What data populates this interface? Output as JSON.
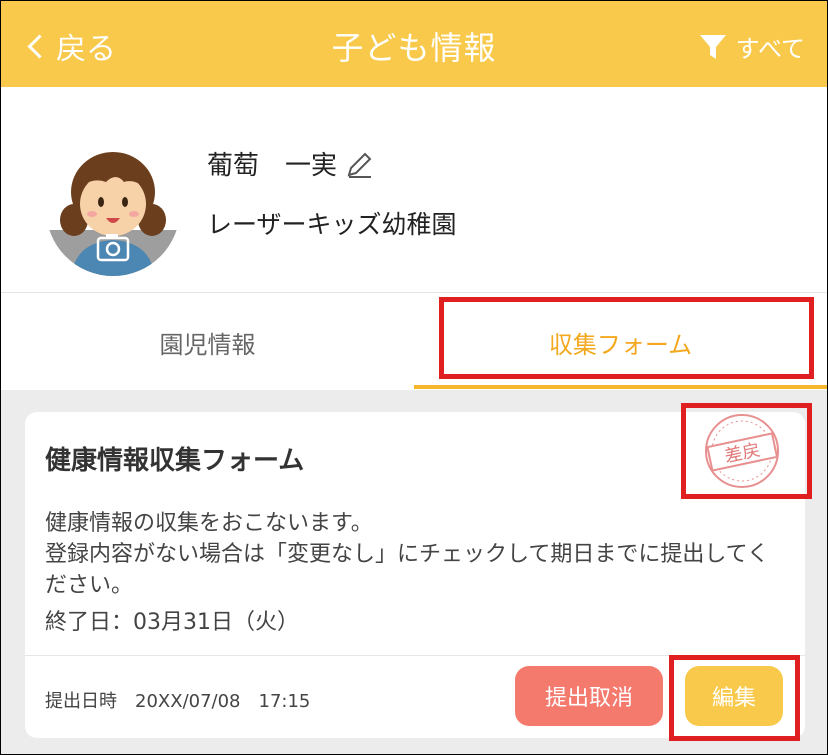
{
  "header": {
    "back_label": "戻る",
    "title": "子ども情報",
    "filter_label": "すべて"
  },
  "profile": {
    "name": "葡萄　一実",
    "school": "レーザーキッズ幼稚園"
  },
  "tabs": [
    {
      "label": "園児情報",
      "active": false
    },
    {
      "label": "収集フォーム",
      "active": true
    }
  ],
  "form_card": {
    "title": "健康情報収集フォーム",
    "description_line1": "健康情報の収集をおこないます。",
    "description_line2": "登録内容がない場合は「変更なし」にチェックして期日までに提出してください。",
    "end_date": "終了日：03月31日（火）",
    "submitted_at": "提出日時　20XX/07/08　17:15",
    "status_stamp": "差戻",
    "cancel_button": "提出取消",
    "edit_button": "編集"
  },
  "colors": {
    "header_bg": "#F8C94A",
    "active_tab": "#F3A81D",
    "cancel_button": "#F47A6E",
    "edit_button": "#F8C94A",
    "highlight": "#E02020",
    "stamp": "#E89090"
  }
}
